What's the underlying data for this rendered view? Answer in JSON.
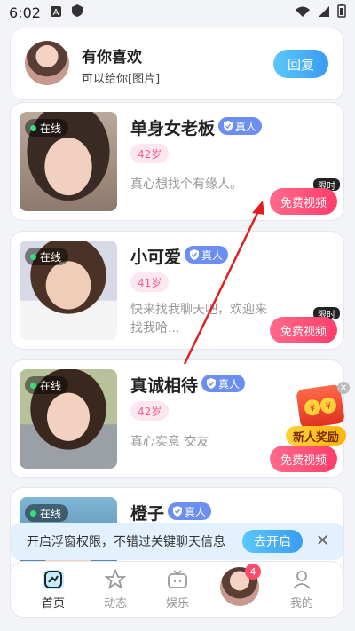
{
  "status": {
    "time": "6:02"
  },
  "message": {
    "title": "有你喜欢",
    "subtitle": "可以给你[图片]",
    "reply_label": "回复"
  },
  "users": [
    {
      "name": "单身女老板",
      "verified": "真人",
      "age": "42岁",
      "bio": "真心想找个有缘人。",
      "online": "在线",
      "video_label": "免费视频",
      "limited": "限时"
    },
    {
      "name": "小可爱",
      "verified": "真人",
      "age": "41岁",
      "bio": "快来找我聊天吧，欢迎来找我哈...",
      "online": "在线",
      "video_label": "免费视频",
      "limited": "限时"
    },
    {
      "name": "真诚相待",
      "verified": "真人",
      "age": "42岁",
      "bio": "真心实意 交友",
      "online": "在线",
      "video_label": "免费视频"
    },
    {
      "name": "橙子",
      "verified": "真人",
      "online": "在线"
    }
  ],
  "reward": {
    "label": "新人奖励"
  },
  "notice": {
    "text": "开启浮窗权限，不错过关键聊天信息",
    "button": "去开启"
  },
  "nav": [
    {
      "label": "首页",
      "active": true
    },
    {
      "label": "动态"
    },
    {
      "label": "娱乐"
    },
    {
      "label": ""
    },
    {
      "label": "我的"
    }
  ],
  "nav_badge": "4",
  "colors": {
    "accent_blue": "#3a9bf0",
    "pink": "#ff3d6b",
    "verified_blue": "#6b8ef0",
    "annotation_red": "#e02020"
  }
}
